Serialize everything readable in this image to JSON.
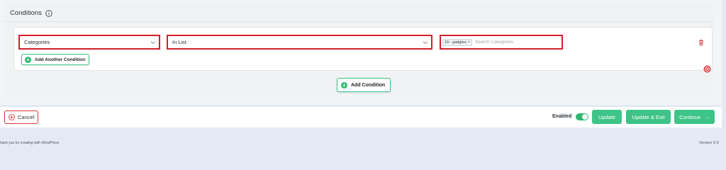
{
  "conditions": {
    "title": "Conditions",
    "rule": {
      "type_value": "Categories",
      "operator_value": "In List",
      "tag_label": "19 - gadgtes",
      "tag_remove": "×",
      "search_placeholder": "Search Categories"
    },
    "add_another_label": "Add Another Condition",
    "add_condition_label": "Add Condition"
  },
  "bottom_bar": {
    "cancel_label": "Cancel",
    "enabled_label": "Enabled",
    "enabled": true,
    "update_label": "Update",
    "update_exit_label": "Update & Exit",
    "continue_label": "Continue",
    "continue_arrow": "→"
  },
  "footer": {
    "thanks_text": "hank you for creating with WordPress.",
    "version_text": "Version 6.9"
  },
  "colors": {
    "accent_green": "#3ec488",
    "danger_red": "#d21f2b"
  }
}
